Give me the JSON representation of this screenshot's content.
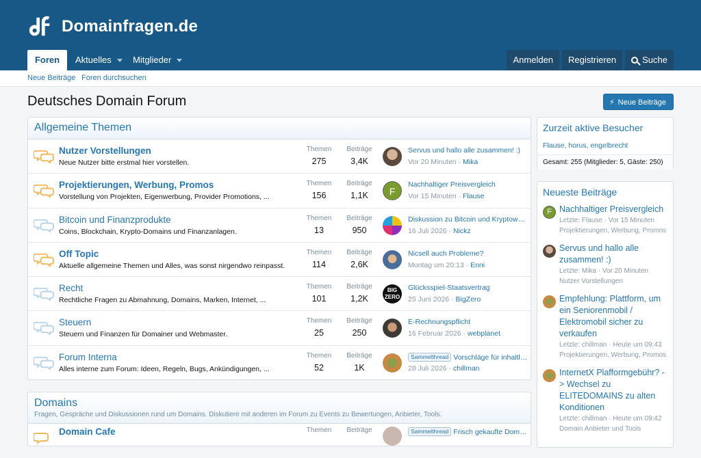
{
  "site": {
    "name": "Domainfragen.de"
  },
  "nav": {
    "tabs": [
      {
        "label": "Foren"
      },
      {
        "label": "Aktuelles"
      },
      {
        "label": "Mitglieder"
      }
    ],
    "login": "Anmelden",
    "register": "Registrieren",
    "search": "Suche"
  },
  "subnav": {
    "new_posts": "Neue Beiträge",
    "search_forums": "Foren durchsuchen"
  },
  "page": {
    "title": "Deutsches Domain Forum",
    "new_posts_button": "Neue Beiträge"
  },
  "categories": [
    {
      "title": "Allgemeine Themen",
      "nodes": [
        {
          "title": "Nutzer Vorstellungen",
          "desc": "Neue Nutzer bitte erstmal hier vorstellen.",
          "themen": "275",
          "beitraege": "3,4K",
          "latest_title": "Servus und hallo alle zusammen! :)",
          "latest_date": "Vor 20 Minuten",
          "latest_user": "Mika",
          "prefix": ""
        },
        {
          "title": "Projektierungen, Werbung, Promos",
          "desc": "Vorstellung von Projekten, Eigenwerbung, Provider Promotions, ...",
          "themen": "156",
          "beitraege": "1,1K",
          "latest_title": "Nachhaltiger Preisvergleich",
          "latest_date": "Vor 15 Minuten",
          "latest_user": "Flause",
          "prefix": ""
        },
        {
          "title": "Bitcoin und Finanzprodukte",
          "desc": "Coins, Blockchain, Krypto-Domains und Finanzanlagen.",
          "themen": "13",
          "beitraege": "950",
          "latest_title": "Diskussion zu Bitcoin und Kryptowährungen",
          "latest_date": "16 Juli 2026",
          "latest_user": "Nickz",
          "prefix": ""
        },
        {
          "title": "Off Topic",
          "desc": "Aktuelle allgemeine Themen und Alles, was sonst nirgendwo reinpasst.",
          "themen": "114",
          "beitraege": "2,6K",
          "latest_title": "Nicsell auch Probleme?",
          "latest_date": "Montag um 20:13",
          "latest_user": "Enni",
          "prefix": ""
        },
        {
          "title": "Recht",
          "desc": "Rechtliche Fragen zu Abmahnung, Domains, Marken, Internet, ...",
          "themen": "101",
          "beitraege": "1,2K",
          "latest_title": "Glücksspiel-Staatsvertrag",
          "latest_date": "25 Juni 2026",
          "latest_user": "BigZero",
          "prefix": ""
        },
        {
          "title": "Steuern",
          "desc": "Steuern und Finanzen für Domainer und Webmaster.",
          "themen": "25",
          "beitraege": "250",
          "latest_title": "E-Rechnungspflicht",
          "latest_date": "16 Februar 2026",
          "latest_user": "webplanet",
          "prefix": ""
        },
        {
          "title": "Forum Interna",
          "desc": "Alles interne zum Forum: Ideen, Regeln, Bugs, Ankündigungen, ...",
          "themen": "52",
          "beitraege": "1K",
          "latest_title": "Vorschläge für inhaltliche Verbesserungen",
          "latest_date": "28 Juli 2026",
          "latest_user": "chillman",
          "prefix": "Sammelthread"
        }
      ]
    },
    {
      "title": "Domains",
      "desc": "Fragen, Gespräche und Diskussionen rund um Domains. Diskutiere mit anderen im Forum zu Events zu Bewertungen, Anbieter, Tools.",
      "nodes": [
        {
          "title": "Domain Cafe",
          "themen_label": "Themen",
          "beitraege_label": "Beiträge",
          "latest_title": "Frisch gekaufte Domains",
          "prefix": "Sammelthread"
        }
      ]
    }
  ],
  "labels": {
    "themen": "Themen",
    "beitraege": "Beiträge"
  },
  "sidebar": {
    "online": {
      "title": "Zurzeit aktive Besucher",
      "users": [
        "Flause",
        "horus",
        "engelbrecht"
      ],
      "total": "Gesamt: 255 (Mitglieder: 5, Gäste: 250)"
    },
    "newest": {
      "title": "Neueste Beiträge",
      "items": [
        {
          "title": "Nachhaltiger Preisvergleich",
          "meta1": "Letzte: Flause · Vor 15 Minuten",
          "meta2": "Projektierungen, Werbung, Promos"
        },
        {
          "title": "Servus und hallo alle zusammen! :)",
          "meta1": "Letzte: Mika · Vor 20 Minuten",
          "meta2": "Nutzer Vorstellungen"
        },
        {
          "title": "Empfehlung: Plattform, um ein Seniorenmobil / Elektromobil sicher zu verkaufen",
          "meta1": "Letzte: chillman · Heute um 09:43",
          "meta2": "Projektierungen, Werbung, Promos"
        },
        {
          "title": "InternetX Plafformgebühr? -> Wechsel zu ELITEDOMAINS zu alten Konditionen",
          "meta1": "Letzte: chillman · Heute um 09:42",
          "meta2": "Domain Anbieter und Tools"
        }
      ]
    }
  },
  "colors": {
    "header": "#185886",
    "link": "#2577b1",
    "unread_icon": "#f2b85c",
    "read_icon": "#b7d4ea"
  }
}
